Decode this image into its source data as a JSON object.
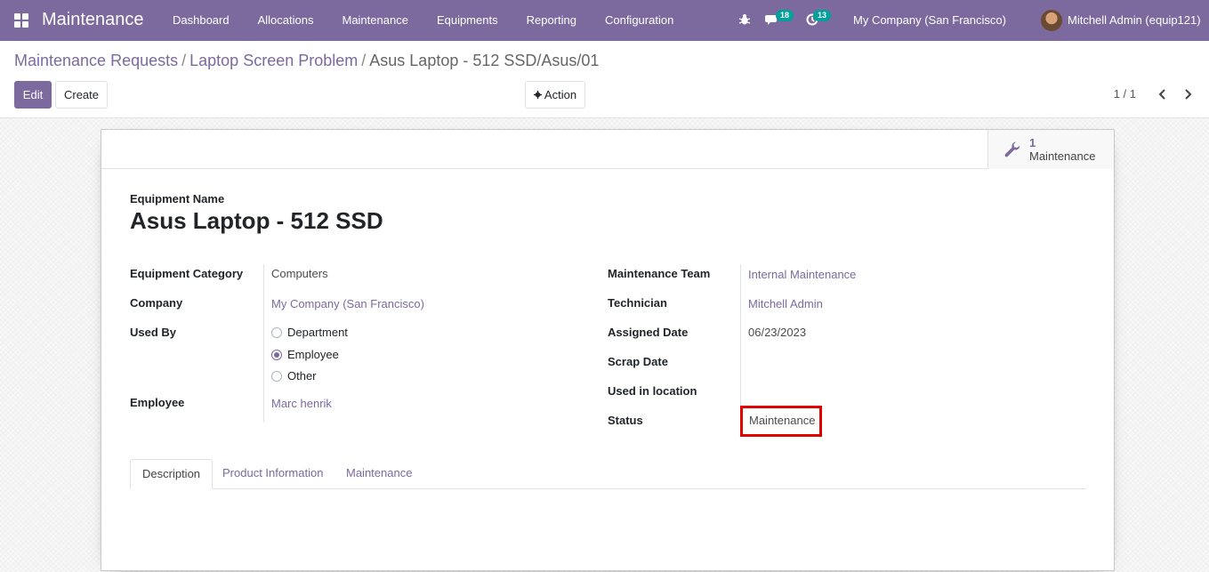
{
  "navbar": {
    "app_name": "Maintenance",
    "menu": [
      "Dashboard",
      "Allocations",
      "Maintenance",
      "Equipments",
      "Reporting",
      "Configuration"
    ],
    "messages_count": "18",
    "activities_count": "13",
    "company": "My Company (San Francisco)",
    "user": "Mitchell Admin (equip121)"
  },
  "breadcrumb": {
    "items": [
      "Maintenance Requests",
      "Laptop Screen Problem"
    ],
    "current": "Asus Laptop - 512 SSD/Asus/01",
    "separator": "/"
  },
  "actions": {
    "edit_label": "Edit",
    "create_label": "Create",
    "action_label": "Action"
  },
  "pager": {
    "value": "1 / 1"
  },
  "stat_button": {
    "value": "1",
    "label": "Maintenance",
    "icon": "wrench-icon"
  },
  "form": {
    "name_label": "Equipment Name",
    "name": "Asus Laptop - 512 SSD",
    "left": {
      "equipment_category_label": "Equipment Category",
      "equipment_category": "Computers",
      "company_label": "Company",
      "company": "My Company (San Francisco)",
      "used_by_label": "Used By",
      "used_by_options": [
        "Department",
        "Employee",
        "Other"
      ],
      "used_by_selected": "Employee",
      "employee_label": "Employee",
      "employee": "Marc henrik"
    },
    "right": {
      "maintenance_team_label": "Maintenance Team",
      "maintenance_team": "Internal Maintenance",
      "technician_label": "Technician",
      "technician": "Mitchell Admin",
      "assigned_date_label": "Assigned Date",
      "assigned_date": "06/23/2023",
      "scrap_date_label": "Scrap Date",
      "used_in_location_label": "Used in location",
      "status_label": "Status",
      "status": "Maintenance"
    }
  },
  "tabs": [
    "Description",
    "Product Information",
    "Maintenance"
  ],
  "active_tab": "Description",
  "colors": {
    "brand": "#7c6a9e",
    "badge": "#00a09d",
    "highlight": "#e00000"
  }
}
